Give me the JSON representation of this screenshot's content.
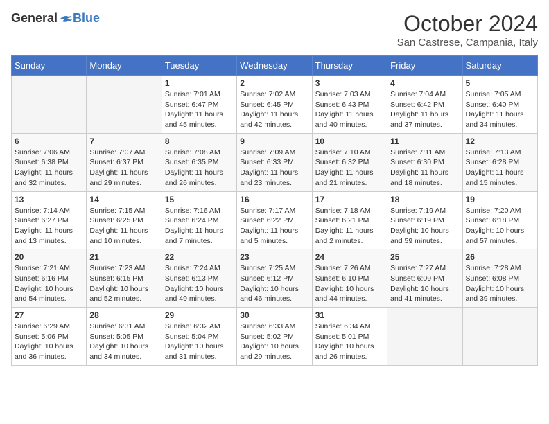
{
  "logo": {
    "general": "General",
    "blue": "Blue"
  },
  "title": "October 2024",
  "location": "San Castrese, Campania, Italy",
  "days_of_week": [
    "Sunday",
    "Monday",
    "Tuesday",
    "Wednesday",
    "Thursday",
    "Friday",
    "Saturday"
  ],
  "weeks": [
    [
      {
        "day": "",
        "info": ""
      },
      {
        "day": "",
        "info": ""
      },
      {
        "day": "1",
        "info": "Sunrise: 7:01 AM\nSunset: 6:47 PM\nDaylight: 11 hours and 45 minutes."
      },
      {
        "day": "2",
        "info": "Sunrise: 7:02 AM\nSunset: 6:45 PM\nDaylight: 11 hours and 42 minutes."
      },
      {
        "day": "3",
        "info": "Sunrise: 7:03 AM\nSunset: 6:43 PM\nDaylight: 11 hours and 40 minutes."
      },
      {
        "day": "4",
        "info": "Sunrise: 7:04 AM\nSunset: 6:42 PM\nDaylight: 11 hours and 37 minutes."
      },
      {
        "day": "5",
        "info": "Sunrise: 7:05 AM\nSunset: 6:40 PM\nDaylight: 11 hours and 34 minutes."
      }
    ],
    [
      {
        "day": "6",
        "info": "Sunrise: 7:06 AM\nSunset: 6:38 PM\nDaylight: 11 hours and 32 minutes."
      },
      {
        "day": "7",
        "info": "Sunrise: 7:07 AM\nSunset: 6:37 PM\nDaylight: 11 hours and 29 minutes."
      },
      {
        "day": "8",
        "info": "Sunrise: 7:08 AM\nSunset: 6:35 PM\nDaylight: 11 hours and 26 minutes."
      },
      {
        "day": "9",
        "info": "Sunrise: 7:09 AM\nSunset: 6:33 PM\nDaylight: 11 hours and 23 minutes."
      },
      {
        "day": "10",
        "info": "Sunrise: 7:10 AM\nSunset: 6:32 PM\nDaylight: 11 hours and 21 minutes."
      },
      {
        "day": "11",
        "info": "Sunrise: 7:11 AM\nSunset: 6:30 PM\nDaylight: 11 hours and 18 minutes."
      },
      {
        "day": "12",
        "info": "Sunrise: 7:13 AM\nSunset: 6:28 PM\nDaylight: 11 hours and 15 minutes."
      }
    ],
    [
      {
        "day": "13",
        "info": "Sunrise: 7:14 AM\nSunset: 6:27 PM\nDaylight: 11 hours and 13 minutes."
      },
      {
        "day": "14",
        "info": "Sunrise: 7:15 AM\nSunset: 6:25 PM\nDaylight: 11 hours and 10 minutes."
      },
      {
        "day": "15",
        "info": "Sunrise: 7:16 AM\nSunset: 6:24 PM\nDaylight: 11 hours and 7 minutes."
      },
      {
        "day": "16",
        "info": "Sunrise: 7:17 AM\nSunset: 6:22 PM\nDaylight: 11 hours and 5 minutes."
      },
      {
        "day": "17",
        "info": "Sunrise: 7:18 AM\nSunset: 6:21 PM\nDaylight: 11 hours and 2 minutes."
      },
      {
        "day": "18",
        "info": "Sunrise: 7:19 AM\nSunset: 6:19 PM\nDaylight: 10 hours and 59 minutes."
      },
      {
        "day": "19",
        "info": "Sunrise: 7:20 AM\nSunset: 6:18 PM\nDaylight: 10 hours and 57 minutes."
      }
    ],
    [
      {
        "day": "20",
        "info": "Sunrise: 7:21 AM\nSunset: 6:16 PM\nDaylight: 10 hours and 54 minutes."
      },
      {
        "day": "21",
        "info": "Sunrise: 7:23 AM\nSunset: 6:15 PM\nDaylight: 10 hours and 52 minutes."
      },
      {
        "day": "22",
        "info": "Sunrise: 7:24 AM\nSunset: 6:13 PM\nDaylight: 10 hours and 49 minutes."
      },
      {
        "day": "23",
        "info": "Sunrise: 7:25 AM\nSunset: 6:12 PM\nDaylight: 10 hours and 46 minutes."
      },
      {
        "day": "24",
        "info": "Sunrise: 7:26 AM\nSunset: 6:10 PM\nDaylight: 10 hours and 44 minutes."
      },
      {
        "day": "25",
        "info": "Sunrise: 7:27 AM\nSunset: 6:09 PM\nDaylight: 10 hours and 41 minutes."
      },
      {
        "day": "26",
        "info": "Sunrise: 7:28 AM\nSunset: 6:08 PM\nDaylight: 10 hours and 39 minutes."
      }
    ],
    [
      {
        "day": "27",
        "info": "Sunrise: 6:29 AM\nSunset: 5:06 PM\nDaylight: 10 hours and 36 minutes."
      },
      {
        "day": "28",
        "info": "Sunrise: 6:31 AM\nSunset: 5:05 PM\nDaylight: 10 hours and 34 minutes."
      },
      {
        "day": "29",
        "info": "Sunrise: 6:32 AM\nSunset: 5:04 PM\nDaylight: 10 hours and 31 minutes."
      },
      {
        "day": "30",
        "info": "Sunrise: 6:33 AM\nSunset: 5:02 PM\nDaylight: 10 hours and 29 minutes."
      },
      {
        "day": "31",
        "info": "Sunrise: 6:34 AM\nSunset: 5:01 PM\nDaylight: 10 hours and 26 minutes."
      },
      {
        "day": "",
        "info": ""
      },
      {
        "day": "",
        "info": ""
      }
    ]
  ]
}
